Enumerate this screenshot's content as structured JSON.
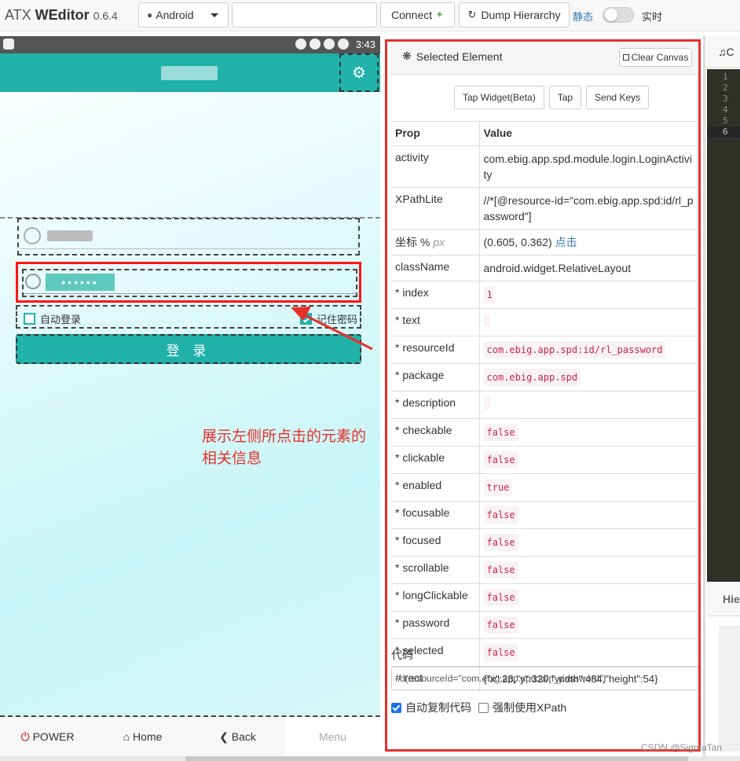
{
  "navbar": {
    "brand_prefix": "ATX ",
    "brand_name": "WEditor",
    "version": "0.6.4",
    "platform": "Android",
    "serial_value": "",
    "connect_label": "Connect",
    "dump_label": "Dump Hierarchy",
    "mode_static": "静态",
    "mode_live": "实时"
  },
  "phone": {
    "status_time": "3:43",
    "auto_login_label": "自动登录",
    "remember_password_label": "记住密码",
    "login_button_label": "登 录",
    "password_mask": "••••••",
    "annotation": "展示左侧所点击的元素的相关信息"
  },
  "phone_nav": {
    "power": "POWER",
    "home": "Home",
    "back": "Back",
    "menu": "Menu"
  },
  "inspector": {
    "title": "Selected Element",
    "clear_canvas": "Clear Canvas",
    "actions": [
      "Tap Widget(Beta)",
      "Tap",
      "Send Keys"
    ],
    "col_prop": "Prop",
    "col_value": "Value",
    "activity_label": "activity",
    "activity_value": "com.ebig.app.spd.module.login.LoginActivity",
    "xpathlite_label": "XPathLite",
    "xpathlite_value": "//*[@resource-id=\"com.ebig.app.spd:id/rl_password\"]",
    "coord_label": "坐标 %",
    "coord_unit": "px",
    "coord_value": "(0.605, 0.362)",
    "coord_link": "点击",
    "classname_label": "className",
    "classname_value": "android.widget.RelativeLayout",
    "props": [
      {
        "label": "* index",
        "value": "1"
      },
      {
        "label": "* text",
        "value": ""
      },
      {
        "label": "* resourceId",
        "value": "com.ebig.app.spd:id/rl_password"
      },
      {
        "label": "* package",
        "value": "com.ebig.app.spd"
      },
      {
        "label": "* description",
        "value": ""
      },
      {
        "label": "* checkable",
        "value": "false"
      },
      {
        "label": "* clickable",
        "value": "false"
      },
      {
        "label": "* enabled",
        "value": "true"
      },
      {
        "label": "* focusable",
        "value": "false"
      },
      {
        "label": "* focused",
        "value": "false"
      },
      {
        "label": "* scrollable",
        "value": "false"
      },
      {
        "label": "* longClickable",
        "value": "false"
      },
      {
        "label": "* password",
        "value": "false"
      },
      {
        "label": "* selected",
        "value": "false"
      }
    ],
    "rect_label": "# rect",
    "rect_value": "{\"x\":28,\"y\":320,\"width\":484,\"height\":54}",
    "code_label": "代码",
    "code_value": "d(resourceId=\"com.ebig.app.spd:id/rl_password\")",
    "auto_copy_label": "自动复制代码",
    "force_xpath_label": "强制使用XPath"
  },
  "editor": {
    "tab_label": "C",
    "line_numbers": [
      "1",
      "2",
      "3",
      "4",
      "5",
      "6"
    ],
    "hierarchy_tab": "Hie"
  },
  "watermark": "CSDN @SigmaTan",
  "colors": {
    "teal": "#20b1a9",
    "highlight_red": "#e8302a",
    "link_blue": "#337ab7"
  }
}
